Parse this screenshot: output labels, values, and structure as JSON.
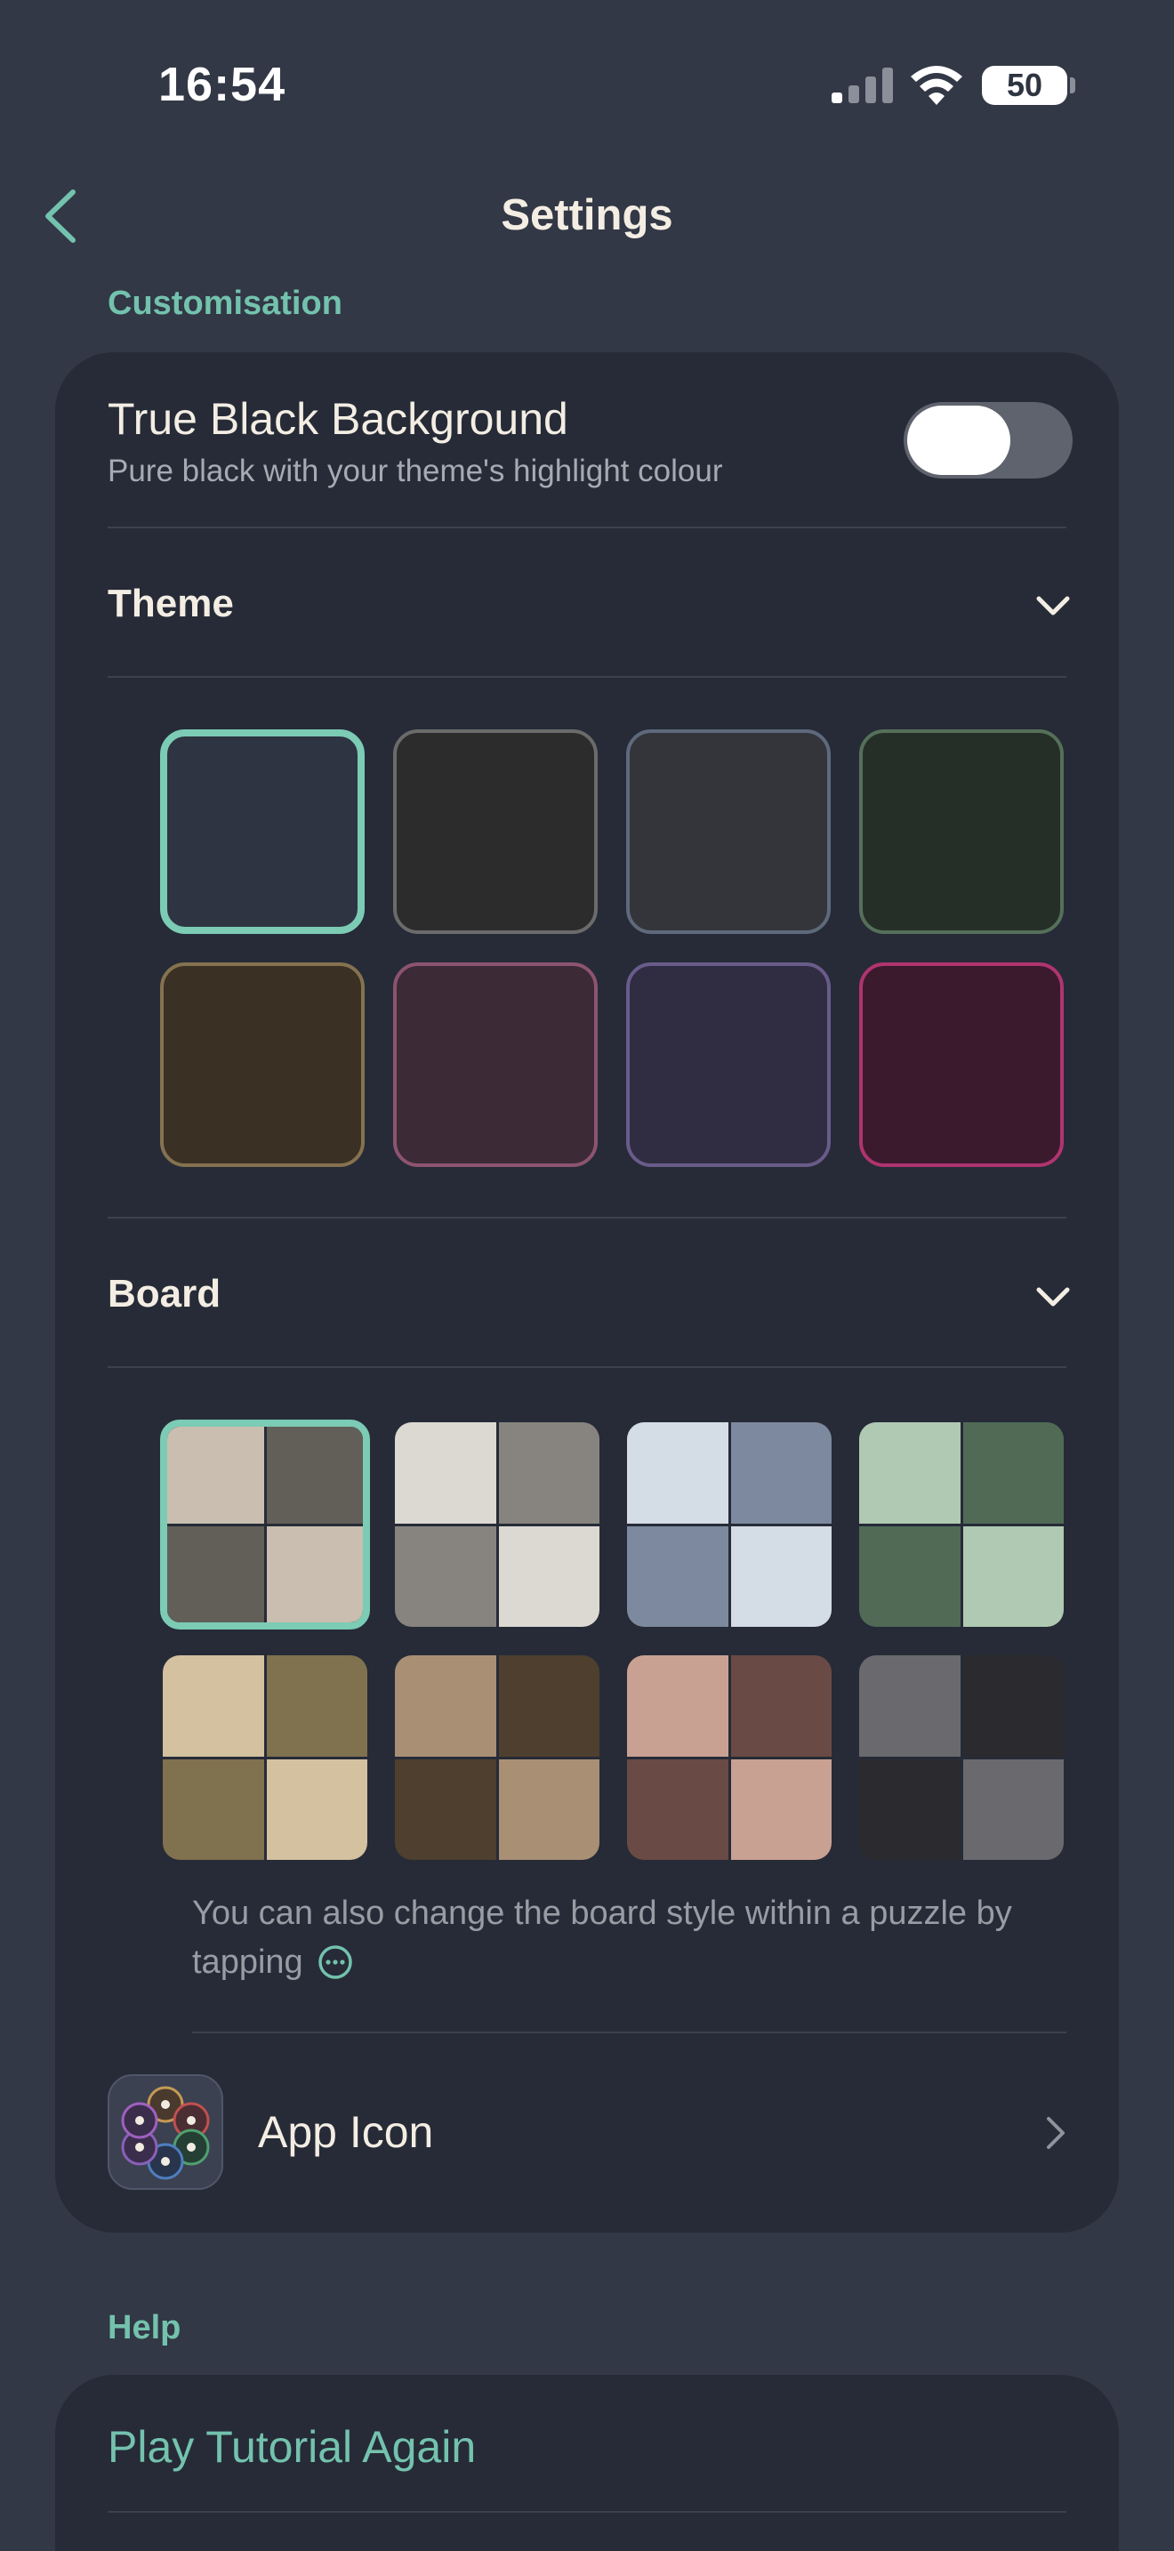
{
  "status_bar": {
    "time": "16:54",
    "battery": "50"
  },
  "nav": {
    "title": "Settings"
  },
  "customisation": {
    "section_label": "Customisation",
    "true_black": {
      "title": "True Black Background",
      "subtitle": "Pure black with your theme's highlight colour",
      "enabled": false
    },
    "theme": {
      "label": "Theme",
      "swatches": [
        {
          "fill": "#2e3441",
          "border": "#7ccbb5",
          "selected": true
        },
        {
          "fill": "#2c2c2c",
          "border": "#6b6b6b",
          "selected": false
        },
        {
          "fill": "#33353b",
          "border": "#5e6a7c",
          "selected": false
        },
        {
          "fill": "#262f27",
          "border": "#55705a",
          "selected": false
        },
        {
          "fill": "#3a3124",
          "border": "#857250",
          "selected": false
        },
        {
          "fill": "#3c2a36",
          "border": "#8c5470",
          "selected": false
        },
        {
          "fill": "#302d42",
          "border": "#6a5c8a",
          "selected": false
        },
        {
          "fill": "#3c1a2e",
          "border": "#b03470",
          "selected": false
        }
      ]
    },
    "board": {
      "label": "Board",
      "styles": [
        {
          "light": "#c9beaf",
          "dark": "#625f59",
          "selected": true
        },
        {
          "light": "#dcd9d3",
          "dark": "#87847f",
          "selected": false
        },
        {
          "light": "#d4dce6",
          "dark": "#7c899e",
          "selected": false
        },
        {
          "light": "#b0c9b3",
          "dark": "#506a56",
          "selected": false
        },
        {
          "light": "#d3c19f",
          "dark": "#80714f",
          "selected": false
        },
        {
          "light": "#a98f74",
          "dark": "#4e3f2f",
          "selected": false
        },
        {
          "light": "#c9a193",
          "dark": "#6a4a45",
          "selected": false
        },
        {
          "light": "#6a6a6e",
          "dark": "#2b2b2f",
          "selected": false
        }
      ],
      "note": "You can also change the board style within a puzzle by tapping"
    },
    "app_icon": {
      "label": "App Icon"
    }
  },
  "help": {
    "section_label": "Help",
    "play_tutorial": "Play Tutorial Again"
  },
  "colors": {
    "accent": "#73c2ad",
    "background": "#323845",
    "card": "#262b37"
  }
}
